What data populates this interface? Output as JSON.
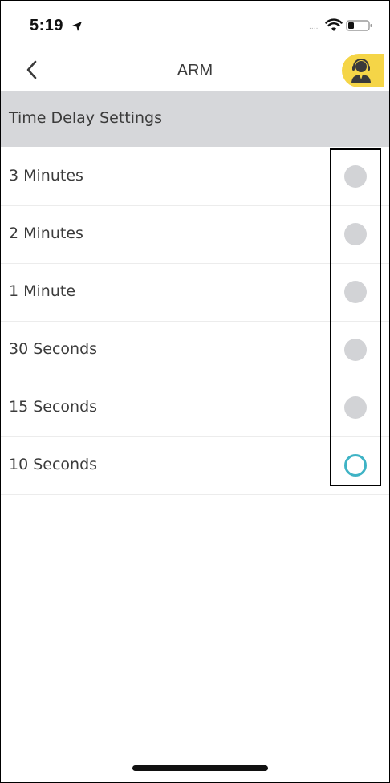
{
  "status_bar": {
    "time": "5:19",
    "location_icon": "location-arrow-icon",
    "signal_indicator": "....",
    "wifi_icon": "wifi-icon",
    "battery_icon": "battery-icon"
  },
  "nav": {
    "back_icon": "chevron-left-icon",
    "title": "ARM",
    "support_icon": "support-agent-icon"
  },
  "section": {
    "header": "Time Delay Settings"
  },
  "options": [
    {
      "label": "3 Minutes",
      "selected": false
    },
    {
      "label": "2 Minutes",
      "selected": false
    },
    {
      "label": "1 Minute",
      "selected": false
    },
    {
      "label": "30 Seconds",
      "selected": false
    },
    {
      "label": "15 Seconds",
      "selected": false
    },
    {
      "label": "10 Seconds",
      "selected": true
    }
  ],
  "colors": {
    "support_button": "#f5d547",
    "section_header_bg": "#d6d7da",
    "radio_unselected": "#d2d3d6",
    "radio_selected": "#3fb3c5"
  }
}
